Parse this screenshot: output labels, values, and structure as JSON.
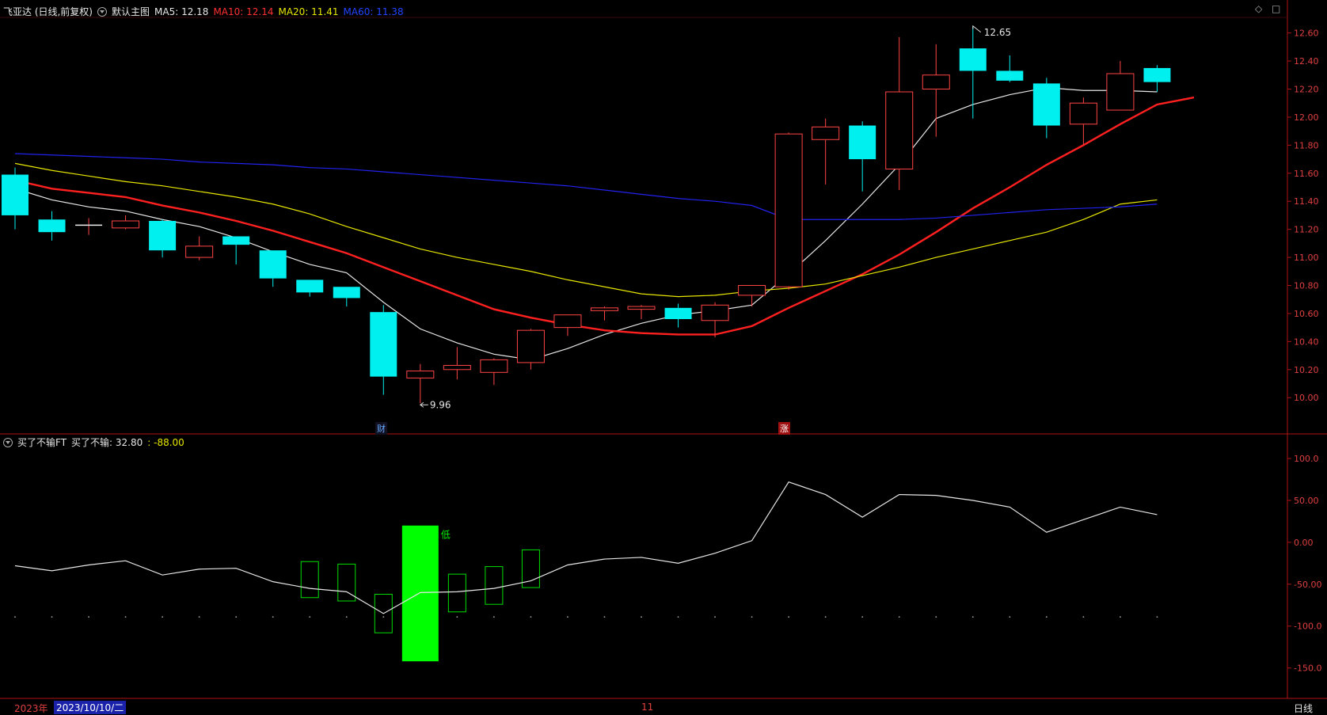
{
  "header": {
    "stock_title": "飞亚达 (日线,前复权)",
    "template": "默认主图",
    "ma": [
      {
        "label": "MA5: 12.18",
        "color": "#e6e6e6"
      },
      {
        "label": "MA10: 12.14",
        "color": "#ff3030"
      },
      {
        "label": "MA20: 11.41",
        "color": "#e6e600"
      },
      {
        "label": "MA60: 11.38",
        "color": "#2233ff"
      }
    ]
  },
  "indicator_header": {
    "name": "买了不输FT",
    "value_label": "买了不输: 32.80",
    "extra_label": ": -88.00"
  },
  "top_right": {
    "diamond": "◇",
    "square": "□"
  },
  "bottom_bar": {
    "year": "2023年",
    "date": "2023/10/10/二",
    "month_tick": "11",
    "period": "日线"
  },
  "markers": {
    "cai": "财",
    "zhang": "涨"
  },
  "chart_data": [
    {
      "type": "candlestick",
      "title": "",
      "ylim": [
        9.86,
        12.66
      ],
      "y_ticks": [
        "12.60",
        "12.40",
        "12.20",
        "12.00",
        "11.80",
        "11.60",
        "11.40",
        "11.20",
        "11.00",
        "10.80",
        "10.60",
        "10.40",
        "10.20",
        "10.00"
      ],
      "candles": [
        {
          "o": 11.3,
          "h": 11.64,
          "l": 11.2,
          "c": 11.59,
          "up": false
        },
        {
          "o": 11.27,
          "h": 11.33,
          "l": 11.12,
          "c": 11.18,
          "up": false
        },
        {
          "o": 11.23,
          "h": 11.28,
          "l": 11.16,
          "c": 11.23,
          "up": true
        },
        {
          "o": 11.21,
          "h": 11.3,
          "l": 11.2,
          "c": 11.26,
          "up": true
        },
        {
          "o": 11.26,
          "h": 11.27,
          "l": 11.0,
          "c": 11.05,
          "up": false
        },
        {
          "o": 11.0,
          "h": 11.15,
          "l": 10.98,
          "c": 11.08,
          "up": true
        },
        {
          "o": 11.15,
          "h": 11.15,
          "l": 10.95,
          "c": 11.09,
          "up": false
        },
        {
          "o": 11.05,
          "h": 11.05,
          "l": 10.79,
          "c": 10.85,
          "up": false
        },
        {
          "o": 10.84,
          "h": 10.84,
          "l": 10.72,
          "c": 10.75,
          "up": false
        },
        {
          "o": 10.79,
          "h": 10.79,
          "l": 10.65,
          "c": 10.71,
          "up": false
        },
        {
          "o": 10.61,
          "h": 10.66,
          "l": 10.02,
          "c": 10.15,
          "up": false
        },
        {
          "o": 10.14,
          "h": 10.24,
          "l": 9.96,
          "c": 10.19,
          "up": true
        },
        {
          "o": 10.2,
          "h": 10.36,
          "l": 10.13,
          "c": 10.23,
          "up": true
        },
        {
          "o": 10.18,
          "h": 10.28,
          "l": 10.09,
          "c": 10.27,
          "up": true
        },
        {
          "o": 10.25,
          "h": 10.49,
          "l": 10.2,
          "c": 10.48,
          "up": true
        },
        {
          "o": 10.5,
          "h": 10.59,
          "l": 10.44,
          "c": 10.59,
          "up": true
        },
        {
          "o": 10.62,
          "h": 10.65,
          "l": 10.55,
          "c": 10.64,
          "up": true
        },
        {
          "o": 10.63,
          "h": 10.66,
          "l": 10.56,
          "c": 10.65,
          "up": true
        },
        {
          "o": 10.64,
          "h": 10.67,
          "l": 10.5,
          "c": 10.56,
          "up": false
        },
        {
          "o": 10.55,
          "h": 10.68,
          "l": 10.43,
          "c": 10.66,
          "up": true
        },
        {
          "o": 10.73,
          "h": 10.8,
          "l": 10.65,
          "c": 10.8,
          "up": true
        },
        {
          "o": 10.79,
          "h": 11.89,
          "l": 10.77,
          "c": 11.88,
          "up": true
        },
        {
          "o": 11.84,
          "h": 11.99,
          "l": 11.52,
          "c": 11.93,
          "up": true
        },
        {
          "o": 11.94,
          "h": 11.97,
          "l": 11.47,
          "c": 11.7,
          "up": false
        },
        {
          "o": 11.63,
          "h": 12.57,
          "l": 11.48,
          "c": 12.18,
          "up": true
        },
        {
          "o": 12.2,
          "h": 12.52,
          "l": 11.86,
          "c": 12.3,
          "up": true
        },
        {
          "o": 12.49,
          "h": 12.65,
          "l": 11.99,
          "c": 12.33,
          "up": false
        },
        {
          "o": 12.33,
          "h": 12.44,
          "l": 12.25,
          "c": 12.26,
          "up": false
        },
        {
          "o": 12.24,
          "h": 12.28,
          "l": 11.85,
          "c": 11.94,
          "up": false
        },
        {
          "o": 11.95,
          "h": 12.14,
          "l": 11.8,
          "c": 12.1,
          "up": true
        },
        {
          "o": 12.05,
          "h": 12.4,
          "l": 12.05,
          "c": 12.31,
          "up": true
        },
        {
          "o": 12.35,
          "h": 12.37,
          "l": 12.18,
          "c": 12.25,
          "up": false
        }
      ],
      "ma_lines": [
        {
          "name": "MA5",
          "color": "#e6e6e6",
          "width": 1.2,
          "values": [
            11.49,
            11.41,
            11.36,
            11.33,
            11.27,
            11.22,
            11.14,
            11.04,
            10.95,
            10.89,
            10.68,
            10.49,
            10.39,
            10.31,
            10.27,
            10.35,
            10.45,
            10.53,
            10.59,
            10.62,
            10.66,
            10.88,
            11.12,
            11.38,
            11.66,
            11.99,
            12.09,
            12.16,
            12.21,
            12.19,
            12.19,
            12.18
          ]
        },
        {
          "name": "MA10",
          "color": "#ff2020",
          "width": 2.4,
          "values": [
            11.55,
            11.49,
            11.46,
            11.43,
            11.37,
            11.32,
            11.26,
            11.19,
            11.11,
            11.03,
            10.93,
            10.83,
            10.73,
            10.63,
            10.57,
            10.52,
            10.48,
            10.46,
            10.45,
            10.45,
            10.51,
            10.64,
            10.76,
            10.88,
            11.02,
            11.18,
            11.35,
            11.5,
            11.66,
            11.8,
            11.95,
            12.09,
            12.14
          ]
        },
        {
          "name": "MA20",
          "color": "#e6e600",
          "width": 1.2,
          "values": [
            11.67,
            11.62,
            11.58,
            11.54,
            11.51,
            11.47,
            11.43,
            11.38,
            11.31,
            11.22,
            11.14,
            11.06,
            11.0,
            10.95,
            10.9,
            10.84,
            10.79,
            10.74,
            10.72,
            10.73,
            10.76,
            10.78,
            10.81,
            10.87,
            10.93,
            11.0,
            11.06,
            11.12,
            11.18,
            11.27,
            11.38,
            11.41
          ]
        },
        {
          "name": "MA60",
          "color": "#2222ee",
          "width": 1.2,
          "values": [
            11.74,
            11.73,
            11.72,
            11.71,
            11.7,
            11.68,
            11.67,
            11.66,
            11.64,
            11.63,
            11.61,
            11.59,
            11.57,
            11.55,
            11.53,
            11.51,
            11.48,
            11.45,
            11.42,
            11.4,
            11.37,
            11.27,
            11.27,
            11.27,
            11.27,
            11.28,
            11.3,
            11.32,
            11.34,
            11.35,
            11.36,
            11.38
          ]
        }
      ],
      "annotations": [
        {
          "text": "12.65"
        },
        {
          "text": "9.96"
        }
      ]
    },
    {
      "type": "line",
      "title": "",
      "ylim": [
        -173,
        118
      ],
      "y_ticks": [
        "100.0",
        "50.00",
        "0.00",
        "-50.00",
        "-100.0",
        "-150.0"
      ],
      "series": [
        {
          "name": "买了不输",
          "color": "#e6e6e6",
          "values": [
            -28,
            -34,
            -27,
            -22,
            -39,
            -32,
            -31,
            -47,
            -55,
            -59,
            -85,
            -60,
            -59,
            -55,
            -46,
            -27,
            -20,
            -18,
            -25,
            -13,
            2,
            72,
            57,
            30,
            57,
            56,
            50,
            42,
            12,
            27,
            42,
            33
          ]
        }
      ],
      "boxes": [
        {
          "i": 8,
          "top": -23,
          "bot": -66,
          "filled": false
        },
        {
          "i": 9,
          "top": -26,
          "bot": -70,
          "filled": false
        },
        {
          "i": 10,
          "top": -62,
          "bot": -108,
          "filled": false
        },
        {
          "i": 11,
          "top": 20,
          "bot": -142,
          "filled": true
        },
        {
          "i": 12,
          "top": -38,
          "bot": -83,
          "filled": false
        },
        {
          "i": 13,
          "top": -29,
          "bot": -74,
          "filled": false
        },
        {
          "i": 14,
          "top": -9,
          "bot": -54,
          "filled": false
        }
      ],
      "labels": [
        {
          "text": "低",
          "i": 11
        }
      ]
    }
  ]
}
